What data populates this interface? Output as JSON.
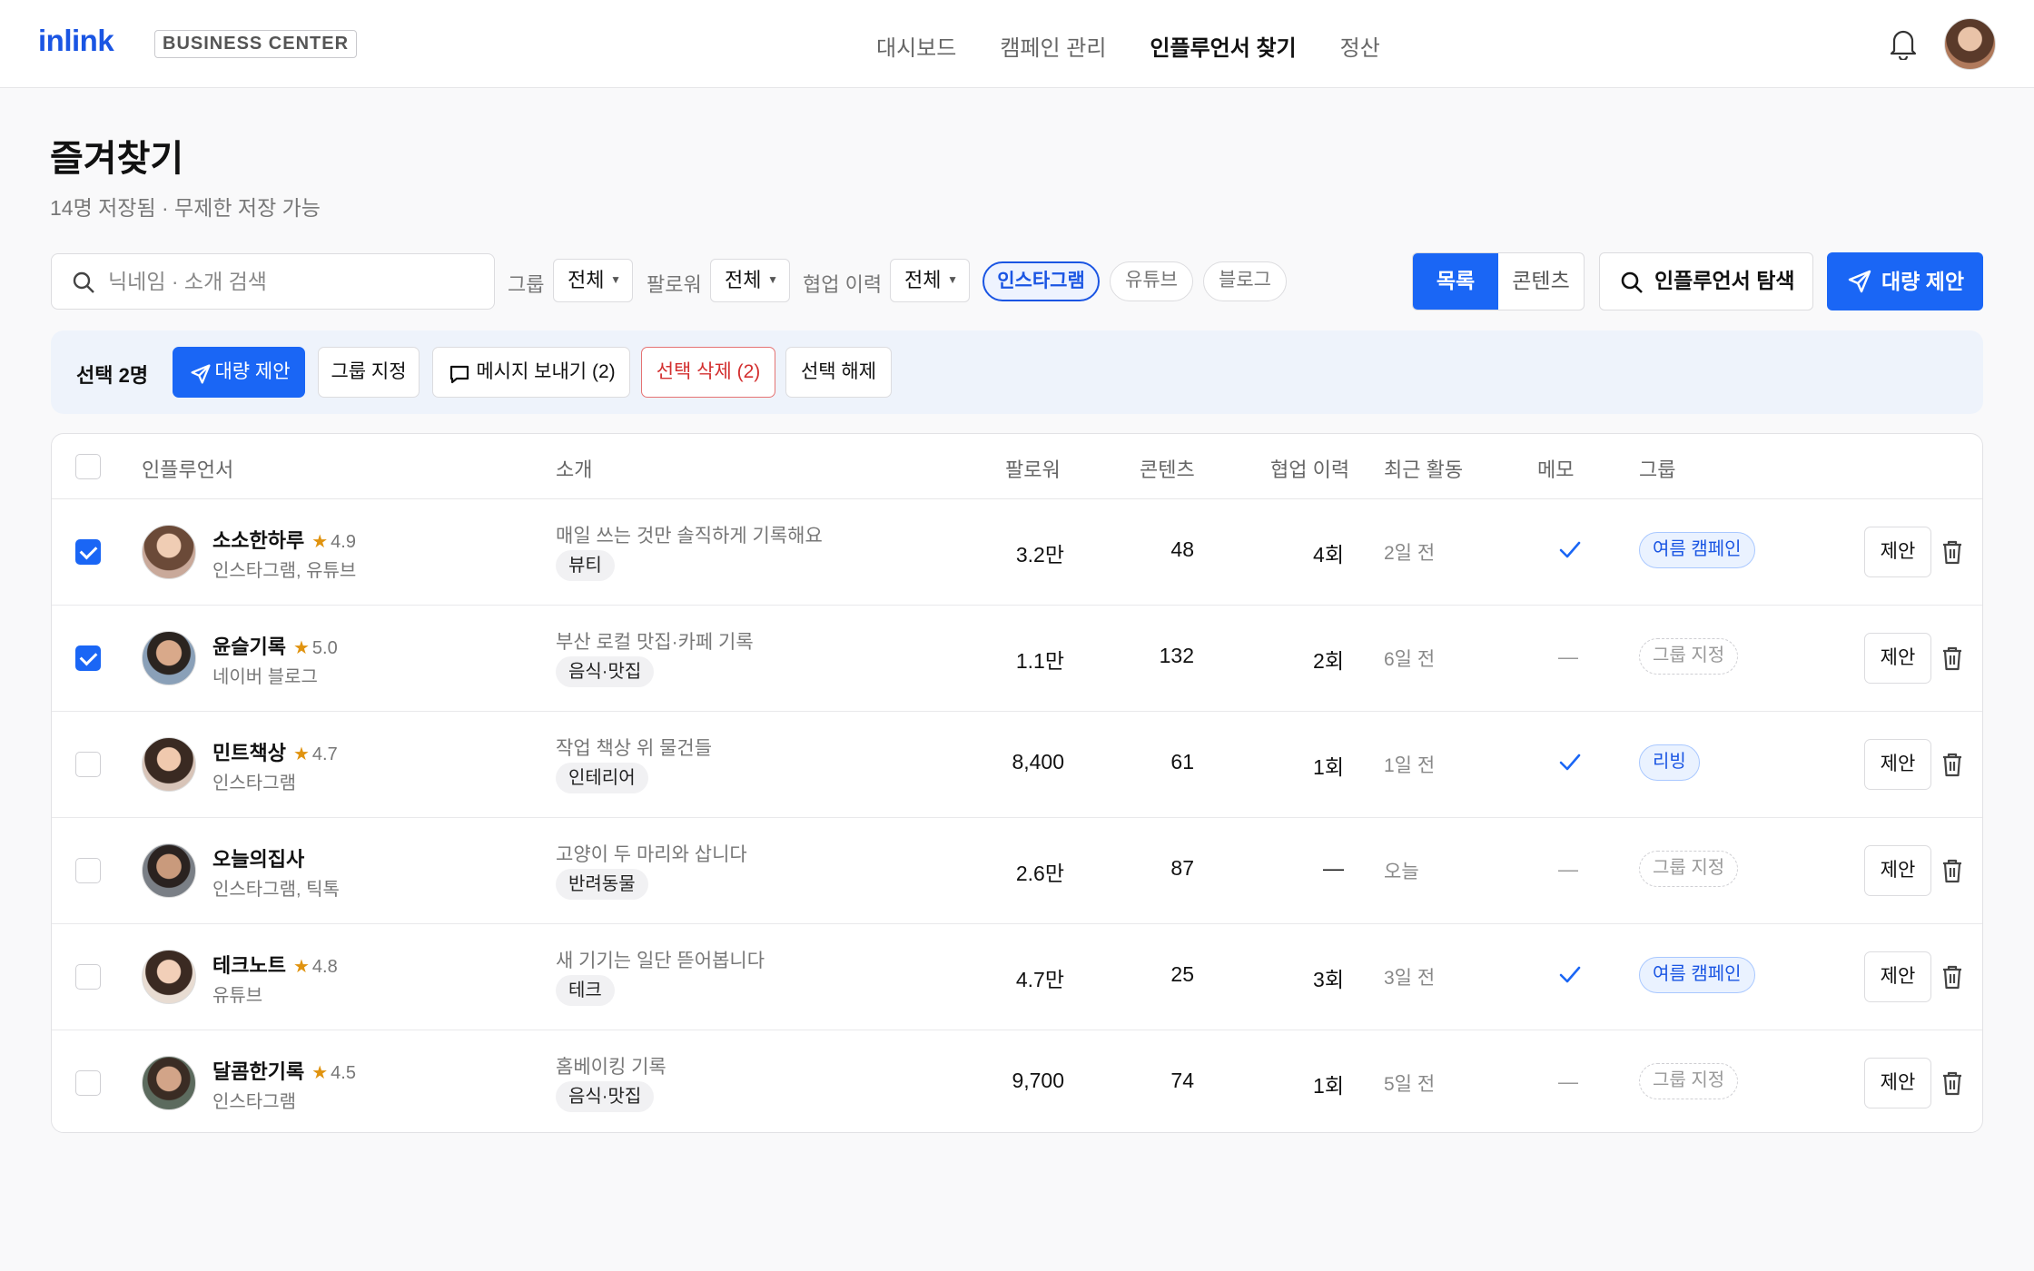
{
  "header": {
    "logo": "inlink",
    "badge": "BUSINESS CENTER",
    "nav": [
      {
        "label": "대시보드",
        "active": false
      },
      {
        "label": "캠페인 관리",
        "active": false
      },
      {
        "label": "인플루언서 찾기",
        "active": true
      },
      {
        "label": "정산",
        "active": false
      }
    ]
  },
  "page": {
    "title": "즐겨찾기",
    "subtitle": "14명 저장됨 · 무제한 저장 가능"
  },
  "filters": {
    "search_placeholder": "닉네임 · 소개 검색",
    "group_label": "그룹",
    "group_value": "전체",
    "follower_label": "팔로워",
    "follower_value": "전체",
    "collab_label": "협업 이력",
    "collab_value": "전체",
    "platform_chips": [
      {
        "label": "인스타그램",
        "active": true
      },
      {
        "label": "유튜브",
        "active": false
      },
      {
        "label": "블로그",
        "active": false
      }
    ],
    "view_list": "목록",
    "view_content": "콘텐츠",
    "explore_button": "인플루언서 탐색",
    "bulk_button": "대량 제안"
  },
  "selection": {
    "count": "선택 2명",
    "bulk_propose": "대량 제안",
    "assign_group": "그룹 지정",
    "send_message": "메시지 보내기 (2)",
    "delete_selected": "선택 삭제 (2)",
    "clear_selection": "선택 해제"
  },
  "table": {
    "headers": {
      "influencer": "인플루언서",
      "intro": "소개",
      "followers": "팔로워",
      "contents": "콘텐츠",
      "collab": "협업 이력",
      "recent": "최근 활동",
      "memo": "메모",
      "group": "그룹"
    },
    "propose_label": "제안",
    "rows": [
      {
        "checked": true,
        "name": "소소한하루",
        "star": "★",
        "rating": "4.9",
        "platforms": "인스타그램, 유튜브",
        "intro": "매일 쓰는 것만 솔직하게 기록해요",
        "category": "뷰티",
        "followers": "3.2만",
        "contents": "48",
        "collab": "4회",
        "recent": "2일 전",
        "memo": true,
        "memo_dash": "",
        "group": "여름 캠페인",
        "group_set": true
      },
      {
        "checked": true,
        "name": "윤슬기록",
        "star": "★",
        "rating": "5.0",
        "platforms": "네이버 블로그",
        "intro": "부산 로컬 맛집·카페 기록",
        "category": "음식·맛집",
        "followers": "1.1만",
        "contents": "132",
        "collab": "2회",
        "recent": "6일 전",
        "memo": false,
        "memo_dash": "—",
        "group": "그룹 지정",
        "group_set": false
      },
      {
        "checked": false,
        "name": "민트책상",
        "star": "★",
        "rating": "4.7",
        "platforms": "인스타그램",
        "intro": "작업 책상 위 물건들",
        "category": "인테리어",
        "followers": "8,400",
        "contents": "61",
        "collab": "1회",
        "recent": "1일 전",
        "memo": true,
        "memo_dash": "",
        "group": "리빙",
        "group_set": true
      },
      {
        "checked": false,
        "name": "오늘의집사",
        "star": "",
        "rating": "",
        "platforms": "인스타그램, 틱톡",
        "intro": "고양이 두 마리와 삽니다",
        "category": "반려동물",
        "followers": "2.6만",
        "contents": "87",
        "collab": "—",
        "recent": "오늘",
        "memo": false,
        "memo_dash": "—",
        "group": "그룹 지정",
        "group_set": false
      },
      {
        "checked": false,
        "name": "테크노트",
        "star": "★",
        "rating": "4.8",
        "platforms": "유튜브",
        "intro": "새 기기는 일단 뜯어봅니다",
        "category": "테크",
        "followers": "4.7만",
        "contents": "25",
        "collab": "3회",
        "recent": "3일 전",
        "memo": true,
        "memo_dash": "",
        "group": "여름 캠페인",
        "group_set": true
      },
      {
        "checked": false,
        "name": "달콤한기록",
        "star": "★",
        "rating": "4.5",
        "platforms": "인스타그램",
        "intro": "홈베이킹 기록",
        "category": "음식·맛집",
        "followers": "9,700",
        "contents": "74",
        "collab": "1회",
        "recent": "5일 전",
        "memo": false,
        "memo_dash": "—",
        "group": "그룹 지정",
        "group_set": false
      }
    ]
  },
  "colors": {
    "accent": "#1a66f5",
    "brand": "#1a55e3",
    "danger": "#d32f2f",
    "star": "#e0930f"
  }
}
